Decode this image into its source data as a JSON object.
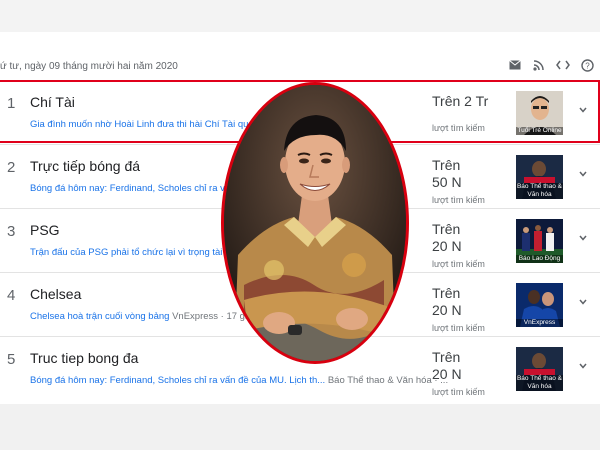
{
  "header": {
    "date": "ứ tư, ngày 09 tháng mười hai năm 2020",
    "icons": [
      "mail-icon",
      "rss-icon",
      "embed-icon",
      "help-icon"
    ]
  },
  "trends": [
    {
      "rank": "1",
      "title": "Chí Tài",
      "article": "Gia đình muốn nhờ Hoài Linh đưa thi hài Chí Tài qua Mỹ",
      "source": "",
      "count": "Trên 2 Tr",
      "count_label": "lượt tìm kiếm",
      "thumb_source": "Tuổi Trẻ Online"
    },
    {
      "rank": "2",
      "title": "Trực tiếp bóng đá",
      "article": "Bóng đá hôm nay: Ferdinand, Scholes chỉ ra vấn đề",
      "source": "",
      "count": "Trên\n50 N",
      "count_label": "lượt tìm kiếm",
      "thumb_source": "Báo Thể thao & Văn hóa"
    },
    {
      "rank": "3",
      "title": "PSG",
      "article": "Trận đấu của PSG phải tổ chức lại vì trọng tài phân",
      "source": "",
      "count": "Trên\n20 N",
      "count_label": "lượt tìm kiếm",
      "thumb_source": "Báo Lao Động"
    },
    {
      "rank": "4",
      "title": "Chelsea",
      "article": "Chelsea hoà trận cuối vòng bảng",
      "source": "VnExpress · 17 giờ trước",
      "count": "Trên\n20 N",
      "count_label": "lượt tìm kiếm",
      "thumb_source": "VnExpress"
    },
    {
      "rank": "5",
      "title": "Truc tiep bong đa",
      "article": "Bóng đá hôm nay: Ferdinand, Scholes chỉ ra vấn đề của MU. Lịch th...",
      "source": "Báo Thể thao & Văn hóa · ...",
      "count": "Trên\n20 N",
      "count_label": "lượt tìm kiếm",
      "thumb_source": "Báo Thể thao & Văn hóa"
    }
  ],
  "colors": {
    "highlight": "#e0001b",
    "link": "#1a73e8"
  }
}
